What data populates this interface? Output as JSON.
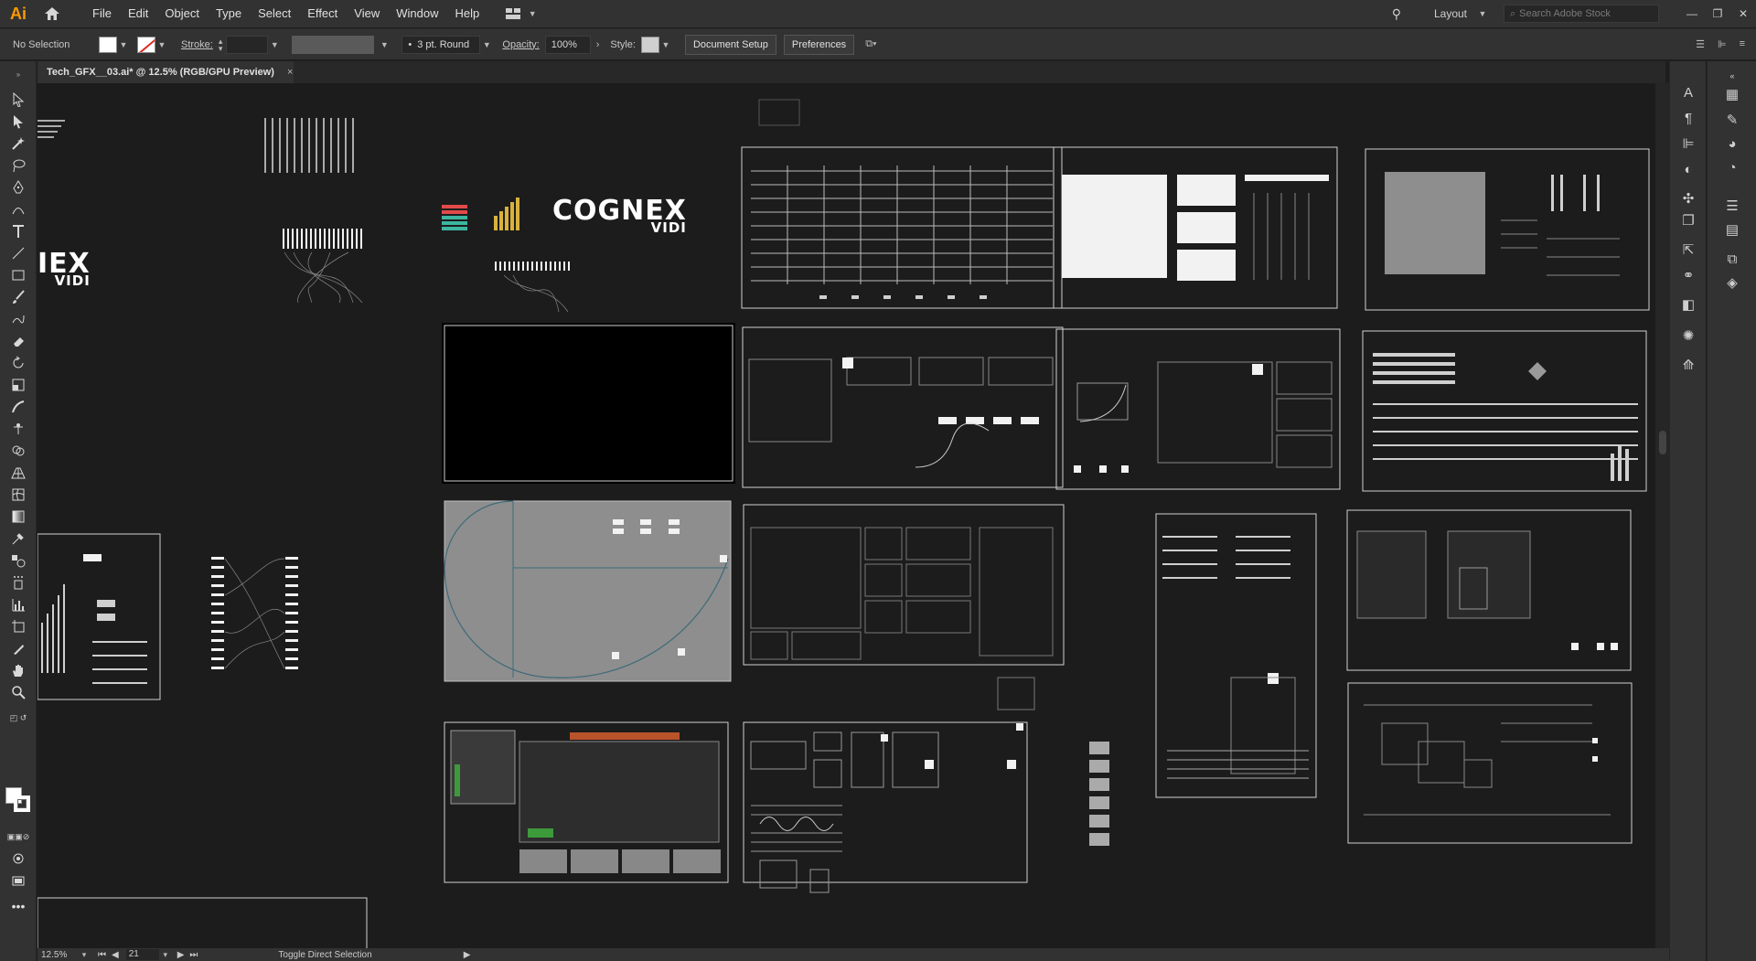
{
  "app": {
    "logo_text": "Ai",
    "menu": [
      "File",
      "Edit",
      "Object",
      "Type",
      "Select",
      "Effect",
      "View",
      "Window",
      "Help"
    ],
    "workspace": "Layout",
    "stock_search_placeholder": "Search Adobe Stock",
    "accent_color": "#ff9a00"
  },
  "control_bar": {
    "selection_state": "No Selection",
    "stroke_label": "Stroke:",
    "brush_value": "3 pt. Round",
    "opacity_label": "Opacity:",
    "opacity_value": "100%",
    "style_label": "Style:",
    "document_setup_label": "Document Setup",
    "preferences_label": "Preferences"
  },
  "document_tab": {
    "title": "Tech_GFX__03.ai* @ 12.5% (RGB/GPU Preview)",
    "close_glyph": "×"
  },
  "canvas": {
    "logos": [
      {
        "text": "COGNEX",
        "sub": "VIDI"
      },
      {
        "text": "IEX",
        "sub": "VIDI"
      }
    ]
  },
  "status_bar": {
    "zoom": "12.5%",
    "artboard_number": "21",
    "tool_hint": "Toggle Direct Selection"
  }
}
